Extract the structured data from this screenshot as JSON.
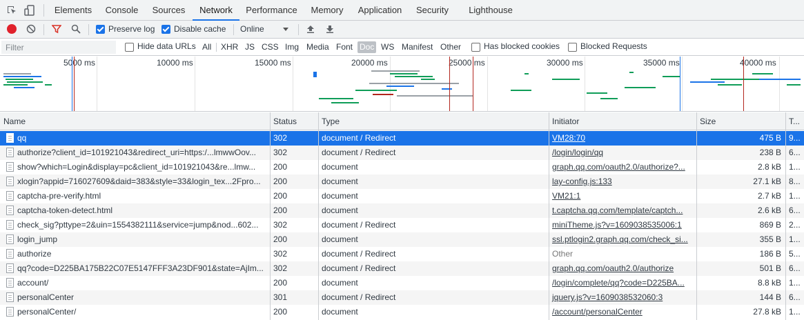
{
  "tabs": [
    {
      "label": "Elements",
      "active": false
    },
    {
      "label": "Console",
      "active": false
    },
    {
      "label": "Sources",
      "active": false
    },
    {
      "label": "Network",
      "active": true
    },
    {
      "label": "Performance",
      "active": false
    },
    {
      "label": "Memory",
      "active": false
    },
    {
      "label": "Application",
      "active": false
    },
    {
      "label": "Security",
      "active": false
    },
    {
      "label": "Lighthouse",
      "active": false
    }
  ],
  "toolbar": {
    "preserve_log": {
      "label": "Preserve log",
      "checked": true
    },
    "disable_cache": {
      "label": "Disable cache",
      "checked": true
    },
    "throttling": "Online"
  },
  "filterbar": {
    "placeholder": "Filter",
    "hide_data_urls": "Hide data URLs",
    "types": [
      "All",
      "XHR",
      "JS",
      "CSS",
      "Img",
      "Media",
      "Font",
      "Doc",
      "WS",
      "Manifest",
      "Other"
    ],
    "selected_type": "Doc",
    "blocked_cookies": "Has blocked cookies",
    "blocked_requests": "Blocked Requests"
  },
  "overview": {
    "ticks": [
      "5000 ms",
      "10000 ms",
      "15000 ms",
      "20000 ms",
      "25000 ms",
      "30000 ms",
      "35000 ms",
      "40000 ms"
    ],
    "colors": {
      "blue": "#1a73e8",
      "green": "#0f9d58",
      "red": "#b3261e",
      "gray": "#9aa0a6",
      "purple": "#9c27b0"
    }
  },
  "table": {
    "columns": [
      "Name",
      "Status",
      "Type",
      "Initiator",
      "Size",
      "T..."
    ],
    "rows": [
      {
        "name": "qq",
        "status": "302",
        "type": "document / Redirect",
        "initiator": "VM28:70",
        "size": "475 B",
        "time": "9...",
        "selected": true
      },
      {
        "name": "authorize?client_id=101921043&redirect_uri=https:/...lmwwOov...",
        "status": "302",
        "type": "document / Redirect",
        "initiator": "/login/login/qq",
        "size": "238 B",
        "time": "6..."
      },
      {
        "name": "show?which=Login&display=pc&client_id=101921043&re...lmw...",
        "status": "200",
        "type": "document",
        "initiator": "graph.qq.com/oauth2.0/authorize?...",
        "size": "2.8 kB",
        "time": "1..."
      },
      {
        "name": "xlogin?appid=716027609&daid=383&style=33&login_tex...2Fpro...",
        "status": "200",
        "type": "document",
        "initiator": "lay-config.js:133",
        "size": "27.1 kB",
        "time": "8..."
      },
      {
        "name": "captcha-pre-verify.html",
        "status": "200",
        "type": "document",
        "initiator": "VM21:1",
        "size": "2.7 kB",
        "time": "1..."
      },
      {
        "name": "captcha-token-detect.html",
        "status": "200",
        "type": "document",
        "initiator": "t.captcha.qq.com/template/captch...",
        "size": "2.6 kB",
        "time": "6..."
      },
      {
        "name": "check_sig?pttype=2&uin=1554382111&service=jump&nod...602...",
        "status": "302",
        "type": "document / Redirect",
        "initiator": "miniTheme.js?v=1609038535006:1",
        "size": "869 B",
        "time": "2..."
      },
      {
        "name": "login_jump",
        "status": "200",
        "type": "document",
        "initiator": "ssl.ptlogin2.graph.qq.com/check_si...",
        "size": "355 B",
        "time": "1..."
      },
      {
        "name": "authorize",
        "status": "302",
        "type": "document / Redirect",
        "initiator": "Other",
        "size": "186 B",
        "time": "5...",
        "plain_initiator": true
      },
      {
        "name": "qq?code=D225BA175B22C07E5147FFF3A23DF901&state=AjIm...",
        "status": "302",
        "type": "document / Redirect",
        "initiator": "graph.qq.com/oauth2.0/authorize",
        "size": "501 B",
        "time": "6..."
      },
      {
        "name": "account/",
        "status": "200",
        "type": "document",
        "initiator": "/login/complete/qq?code=D225BA...",
        "size": "8.8 kB",
        "time": "1..."
      },
      {
        "name": "personalCenter",
        "status": "301",
        "type": "document / Redirect",
        "initiator": "jquery.js?v=1609038532060:3",
        "size": "144 B",
        "time": "6..."
      },
      {
        "name": "personalCenter/",
        "status": "200",
        "type": "document",
        "initiator": "/account/personalCenter",
        "size": "27.8 kB",
        "time": "1..."
      }
    ]
  }
}
